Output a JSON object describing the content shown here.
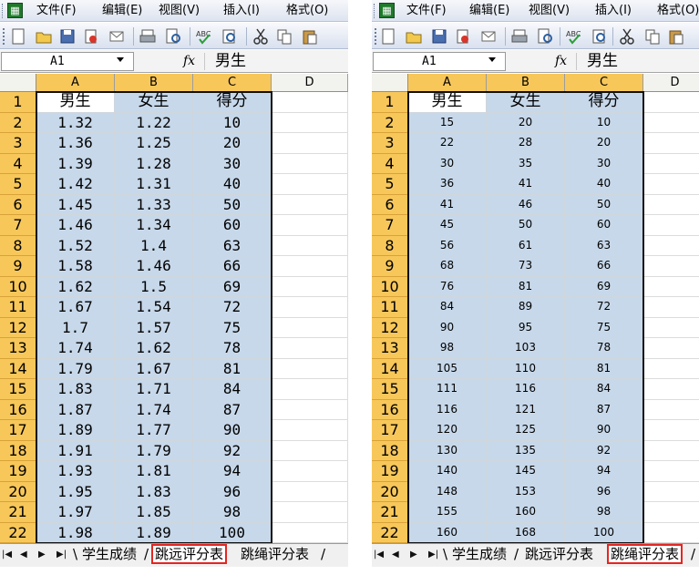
{
  "menus": [
    "文件(F)",
    "编辑(E)",
    "视图(V)",
    "插入(I)",
    "格式(O)"
  ],
  "app_icon": "excel-icon",
  "toolbar_icons": [
    "new-icon",
    "open-icon",
    "save-icon",
    "permission-icon",
    "email-icon",
    "print-icon",
    "print-preview-icon",
    "spelling-icon",
    "research-icon",
    "cut-icon",
    "copy-icon",
    "paste-icon"
  ],
  "colors": {
    "row_header": "#f7c75a",
    "selection": "#c7d8ea",
    "tab_highlight": "#e42621"
  },
  "panes": [
    {
      "name_box": "A1",
      "fx_label": "fx",
      "formula": "男生",
      "columns": [
        "A",
        "B",
        "C",
        "D"
      ],
      "rows": [
        [
          "1",
          "男生",
          "女生",
          "得分"
        ],
        [
          "2",
          "1.32",
          "1.22",
          "10"
        ],
        [
          "3",
          "1.36",
          "1.25",
          "20"
        ],
        [
          "4",
          "1.39",
          "1.28",
          "30"
        ],
        [
          "5",
          "1.42",
          "1.31",
          "40"
        ],
        [
          "6",
          "1.45",
          "1.33",
          "50"
        ],
        [
          "7",
          "1.46",
          "1.34",
          "60"
        ],
        [
          "8",
          "1.52",
          "1.4",
          "63"
        ],
        [
          "9",
          "1.58",
          "1.46",
          "66"
        ],
        [
          "10",
          "1.62",
          "1.5",
          "69"
        ],
        [
          "11",
          "1.67",
          "1.54",
          "72"
        ],
        [
          "12",
          "1.7",
          "1.57",
          "75"
        ],
        [
          "13",
          "1.74",
          "1.62",
          "78"
        ],
        [
          "14",
          "1.79",
          "1.67",
          "81"
        ],
        [
          "15",
          "1.83",
          "1.71",
          "84"
        ],
        [
          "16",
          "1.87",
          "1.74",
          "87"
        ],
        [
          "17",
          "1.89",
          "1.77",
          "90"
        ],
        [
          "18",
          "1.91",
          "1.79",
          "92"
        ],
        [
          "19",
          "1.93",
          "1.81",
          "94"
        ],
        [
          "20",
          "1.95",
          "1.83",
          "96"
        ],
        [
          "21",
          "1.97",
          "1.85",
          "98"
        ],
        [
          "22",
          "1.98",
          "1.89",
          "100"
        ]
      ],
      "tab_nav": [
        "|◀",
        "◀",
        "▶",
        "▶|"
      ],
      "tabs": [
        {
          "label": "学生成绩",
          "active": false,
          "highlight": false
        },
        {
          "label": "跳远评分表",
          "active": true,
          "highlight": true
        },
        {
          "label": "跳绳评分表",
          "active": false,
          "highlight": false
        }
      ]
    },
    {
      "name_box": "A1",
      "fx_label": "fx",
      "formula": "男生",
      "columns": [
        "A",
        "B",
        "C",
        "D"
      ],
      "rows": [
        [
          "1",
          "男生",
          "女生",
          "得分"
        ],
        [
          "2",
          "15",
          "20",
          "10"
        ],
        [
          "3",
          "22",
          "28",
          "20"
        ],
        [
          "4",
          "30",
          "35",
          "30"
        ],
        [
          "5",
          "36",
          "41",
          "40"
        ],
        [
          "6",
          "41",
          "46",
          "50"
        ],
        [
          "7",
          "45",
          "50",
          "60"
        ],
        [
          "8",
          "56",
          "61",
          "63"
        ],
        [
          "9",
          "68",
          "73",
          "66"
        ],
        [
          "10",
          "76",
          "81",
          "69"
        ],
        [
          "11",
          "84",
          "89",
          "72"
        ],
        [
          "12",
          "90",
          "95",
          "75"
        ],
        [
          "13",
          "98",
          "103",
          "78"
        ],
        [
          "14",
          "105",
          "110",
          "81"
        ],
        [
          "15",
          "111",
          "116",
          "84"
        ],
        [
          "16",
          "116",
          "121",
          "87"
        ],
        [
          "17",
          "120",
          "125",
          "90"
        ],
        [
          "18",
          "130",
          "135",
          "92"
        ],
        [
          "19",
          "140",
          "145",
          "94"
        ],
        [
          "20",
          "148",
          "153",
          "96"
        ],
        [
          "21",
          "155",
          "160",
          "98"
        ],
        [
          "22",
          "160",
          "168",
          "100"
        ]
      ],
      "tab_nav": [
        "|◀",
        "◀",
        "▶",
        "▶|"
      ],
      "tabs": [
        {
          "label": "学生成绩",
          "active": false,
          "highlight": false
        },
        {
          "label": "跳远评分表",
          "active": false,
          "highlight": false
        },
        {
          "label": "跳绳评分表",
          "active": true,
          "highlight": true
        }
      ]
    }
  ]
}
